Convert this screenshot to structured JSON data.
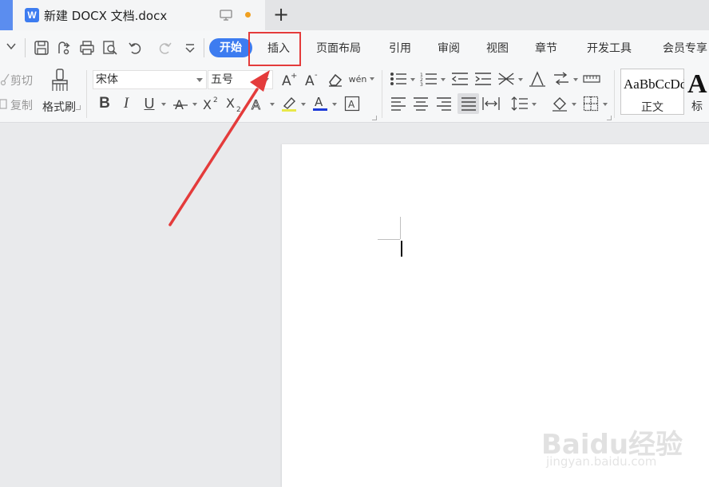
{
  "window": {
    "doc_icon_letter": "W",
    "doc_title": "新建 DOCX 文档.docx",
    "new_tab_label": "+"
  },
  "menu": {
    "active_tab": "开始",
    "tabs": [
      "插入",
      "页面布局",
      "引用",
      "审阅",
      "视图",
      "章节",
      "开发工具",
      "会员专享"
    ]
  },
  "ribbon": {
    "cut_label": "剪切",
    "copy_label": "复制",
    "format_painter_label": "格式刷",
    "font_name": "宋体",
    "font_size": "五号",
    "bold_glyph": "B",
    "italic_glyph": "I",
    "underline_glyph": "U",
    "phonetic_glyph": "wén",
    "style_normal_preview": "AaBbCcDd",
    "style_normal_name": "正文",
    "style_heading_preview": "A",
    "style_heading_name": "标"
  },
  "watermark": {
    "main": "Baidu经验",
    "sub": "jingyan.baidu.com"
  },
  "colors": {
    "accent": "#3d7cf0",
    "highlight_box": "#e43b3b",
    "arrow": "#e43b3b",
    "unsaved_dot": "#f0a020"
  }
}
